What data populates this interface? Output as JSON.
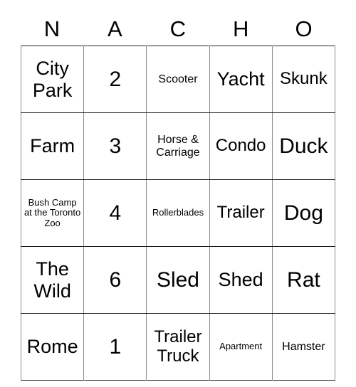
{
  "card": {
    "header_letters": [
      "N",
      "A",
      "C",
      "H",
      "O"
    ],
    "columns": [
      "N",
      "A",
      "C",
      "H",
      "O"
    ],
    "rows": [
      [
        {
          "text": "City Park",
          "size": "lg"
        },
        {
          "text": "2",
          "size": "num"
        },
        {
          "text": "Scooter",
          "size": "sm"
        },
        {
          "text": "Yacht",
          "size": "lg"
        },
        {
          "text": "Skunk",
          "size": "md"
        }
      ],
      [
        {
          "text": "Farm",
          "size": "lg"
        },
        {
          "text": "3",
          "size": "num"
        },
        {
          "text": "Horse & Carriage",
          "size": "sm"
        },
        {
          "text": "Condo",
          "size": "md"
        },
        {
          "text": "Duck",
          "size": "xl"
        }
      ],
      [
        {
          "text": "Bush Camp at the Toronto Zoo",
          "size": "xs"
        },
        {
          "text": "4",
          "size": "num"
        },
        {
          "text": "Rollerblades",
          "size": "xs"
        },
        {
          "text": "Trailer",
          "size": "md"
        },
        {
          "text": "Dog",
          "size": "xl"
        }
      ],
      [
        {
          "text": "The Wild",
          "size": "lg"
        },
        {
          "text": "6",
          "size": "num"
        },
        {
          "text": "Sled",
          "size": "xl"
        },
        {
          "text": "Shed",
          "size": "lg"
        },
        {
          "text": "Rat",
          "size": "xl"
        }
      ],
      [
        {
          "text": "Rome",
          "size": "lg"
        },
        {
          "text": "1",
          "size": "num"
        },
        {
          "text": "Trailer Truck",
          "size": "md"
        },
        {
          "text": "Apartment",
          "size": "xs"
        },
        {
          "text": "Hamster",
          "size": "sm"
        }
      ]
    ]
  },
  "colors": {
    "background": "#ffffff",
    "text": "#000000",
    "grid_line_horizontal": "#1a1a1a",
    "grid_line_vertical": "#8a8a8a"
  }
}
